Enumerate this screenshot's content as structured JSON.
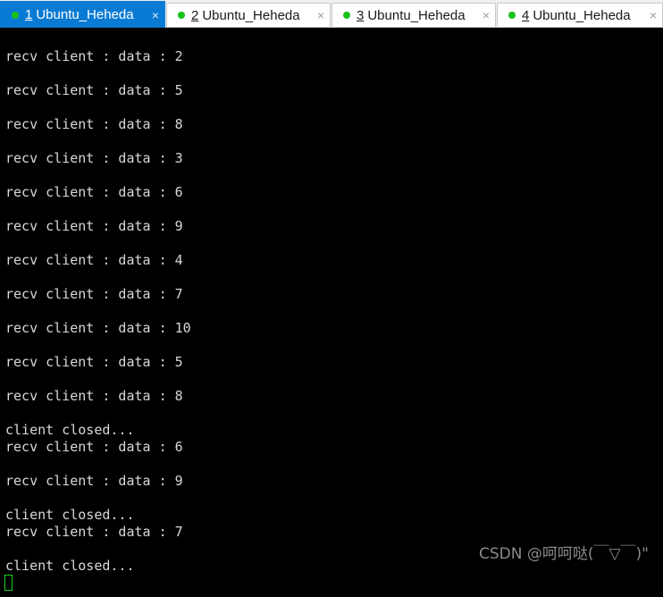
{
  "tabs": [
    {
      "number": "1",
      "label": "Ubuntu_Heheda",
      "active": true
    },
    {
      "number": "2",
      "label": "Ubuntu_Heheda",
      "active": false
    },
    {
      "number": "3",
      "label": "Ubuntu_Heheda",
      "active": false
    },
    {
      "number": "4",
      "label": "Ubuntu_Heheda",
      "active": false
    }
  ],
  "close_glyph": "×",
  "terminal": {
    "lines": [
      "recv client : data : 2",
      "recv client : data : 5",
      "recv client : data : 8",
      "recv client : data : 3",
      "recv client : data : 6",
      "recv client : data : 9",
      "recv client : data : 4",
      "recv client : data : 7",
      "recv client : data : 10",
      "recv client : data : 5",
      "recv client : data : 8",
      "client closed...",
      "recv client : data : 6",
      "recv client : data : 9",
      "client closed...",
      "recv client : data : 7",
      "client closed..."
    ]
  },
  "watermark": "CSDN @呵呵哒(￣▽￣)\"",
  "colors": {
    "active_tab": "#0a7bd4",
    "status_dot": "#19c219",
    "terminal_bg": "#000000",
    "terminal_fg": "#d8d8d8",
    "cursor": "#19d219"
  }
}
